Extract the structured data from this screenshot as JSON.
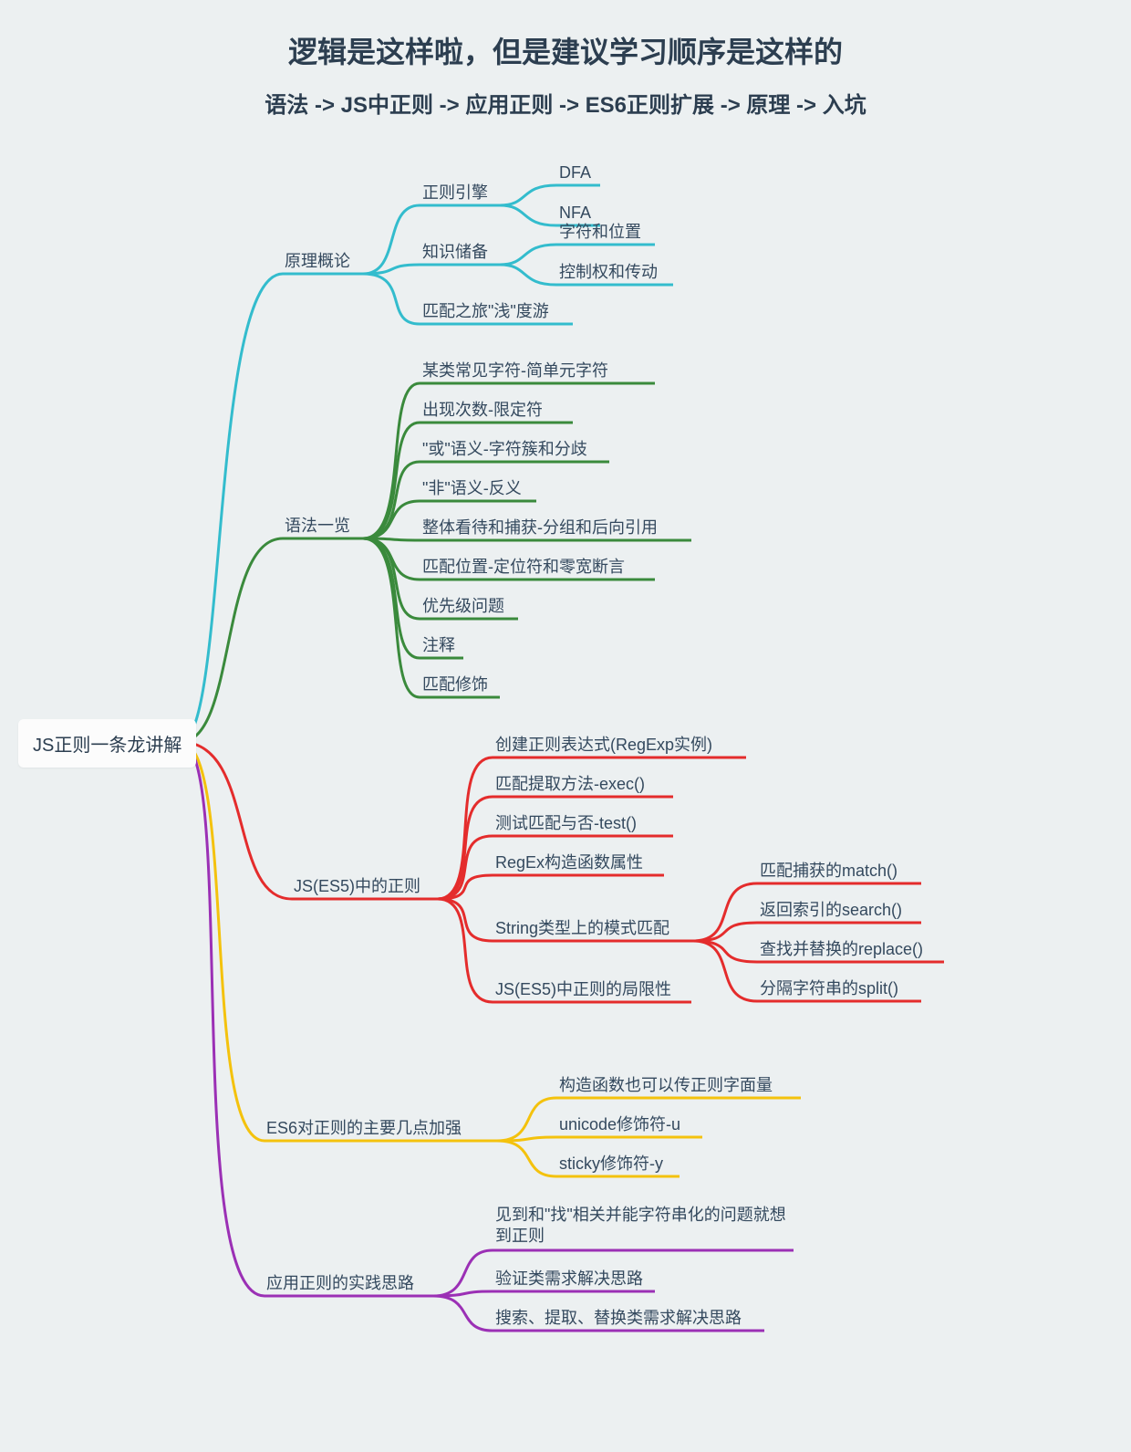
{
  "title": "逻辑是这样啦，但是建议学习顺序是这样的",
  "subtitle": "语法 -> JS中正则 -> 应用正则 -> ES6正则扩展 -> 原理 -> 入坑",
  "root": "JS正则一条龙讲解",
  "colors": {
    "cyan": "#33bccd",
    "green": "#3a8a3c",
    "red": "#e42c2c",
    "yellow": "#f4c20d",
    "purple": "#9b30b5"
  },
  "branches": {
    "b0": {
      "label": "原理概论",
      "children": {
        "c0": {
          "label": "正则引擎",
          "children": {
            "d0": "DFA",
            "d1": "NFA"
          }
        },
        "c1": {
          "label": "知识储备",
          "children": {
            "d0": "字符和位置",
            "d1": "控制权和传动"
          }
        },
        "c2": {
          "label": "匹配之旅\"浅\"度游"
        }
      }
    },
    "b1": {
      "label": "语法一览",
      "children": {
        "c0": "某类常见字符-简单元字符",
        "c1": "出现次数-限定符",
        "c2": "\"或\"语义-字符簇和分歧",
        "c3": "\"非\"语义-反义",
        "c4": "整体看待和捕获-分组和后向引用",
        "c5": "匹配位置-定位符和零宽断言",
        "c6": "优先级问题",
        "c7": "注释",
        "c8": "匹配修饰"
      }
    },
    "b2": {
      "label": "JS(ES5)中的正则",
      "children": {
        "c0": "创建正则表达式(RegExp实例)",
        "c1": "匹配提取方法-exec()",
        "c2": "测试匹配与否-test()",
        "c3": "RegEx构造函数属性",
        "c4": {
          "label": "String类型上的模式匹配",
          "children": {
            "d0": "匹配捕获的match()",
            "d1": "返回索引的search()",
            "d2": "查找并替换的replace()",
            "d3": "分隔字符串的split()"
          }
        },
        "c5": "JS(ES5)中正则的局限性"
      }
    },
    "b3": {
      "label": "ES6对正则的主要几点加强",
      "children": {
        "c0": "构造函数也可以传正则字面量",
        "c1": "unicode修饰符-u",
        "c2": "sticky修饰符-y"
      }
    },
    "b4": {
      "label": "应用正则的实践思路",
      "children": {
        "c0": "见到和\"找\"相关并能字符串化的问题就想到正则",
        "c1": "验证类需求解决思路",
        "c2": "搜索、提取、替换类需求解决思路"
      }
    }
  }
}
